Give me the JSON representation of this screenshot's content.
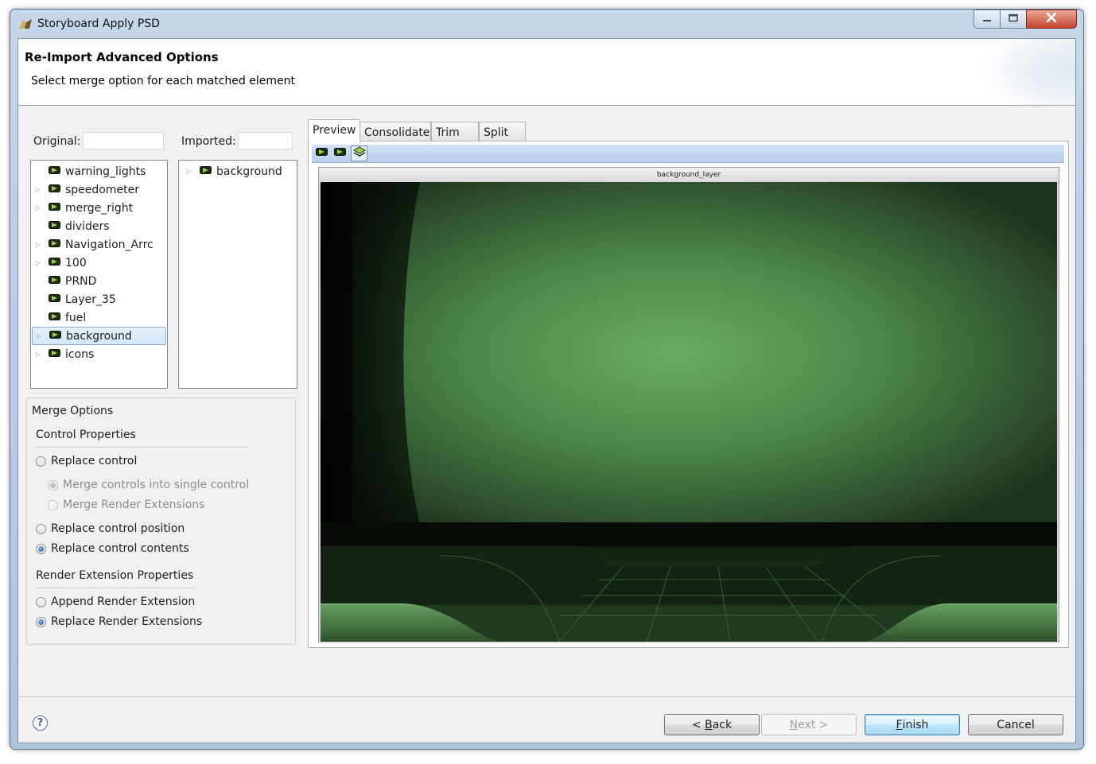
{
  "window": {
    "title": "Storyboard Apply PSD"
  },
  "header": {
    "title": "Re-Import Advanced Options",
    "subtitle": "Select merge option for each matched element"
  },
  "original": {
    "label": "Original:",
    "filter_value": "",
    "items": [
      {
        "label": "warning_lights",
        "expandable": false
      },
      {
        "label": "speedometer",
        "expandable": true
      },
      {
        "label": "merge_right",
        "expandable": true
      },
      {
        "label": "dividers",
        "expandable": false
      },
      {
        "label": "Navigation_Arrc",
        "expandable": true
      },
      {
        "label": "100",
        "expandable": true
      },
      {
        "label": "PRND",
        "expandable": false
      },
      {
        "label": "Layer_35",
        "expandable": false
      },
      {
        "label": "fuel",
        "expandable": false
      },
      {
        "label": "background",
        "expandable": true,
        "selected": true
      },
      {
        "label": "icons",
        "expandable": true
      }
    ]
  },
  "imported": {
    "label": "Imported:",
    "filter_value": "",
    "items": [
      {
        "label": "background",
        "expandable": true
      }
    ]
  },
  "merge_options": {
    "title": "Merge Options",
    "control_properties": {
      "heading": "Control Properties",
      "replace_control": "Replace control",
      "merge_single": "Merge controls into single control",
      "merge_render": "Merge Render Extensions",
      "replace_position": "Replace control position",
      "replace_contents": "Replace control contents",
      "selected": "replace_contents"
    },
    "render_extension_properties": {
      "heading": "Render Extension Properties",
      "append": "Append Render Extension",
      "replace": "Replace Render Extensions",
      "selected": "replace"
    }
  },
  "tabs": [
    {
      "label": "Preview",
      "active": true
    },
    {
      "label": "Consolidate"
    },
    {
      "label": "Trim"
    },
    {
      "label": "Split"
    }
  ],
  "preview": {
    "layer_label": "background_layer"
  },
  "buttons": {
    "back_prefix": "< ",
    "back_mn": "B",
    "back_rest": "ack",
    "next_mn": "N",
    "next_rest": "ext >",
    "finish_mn": "F",
    "finish_rest": "inish",
    "cancel": "Cancel",
    "help": "?"
  },
  "colors": {
    "accent": "#3c7fb1",
    "preview_green": "#64a85f",
    "title_bar": "#b9cde6"
  }
}
